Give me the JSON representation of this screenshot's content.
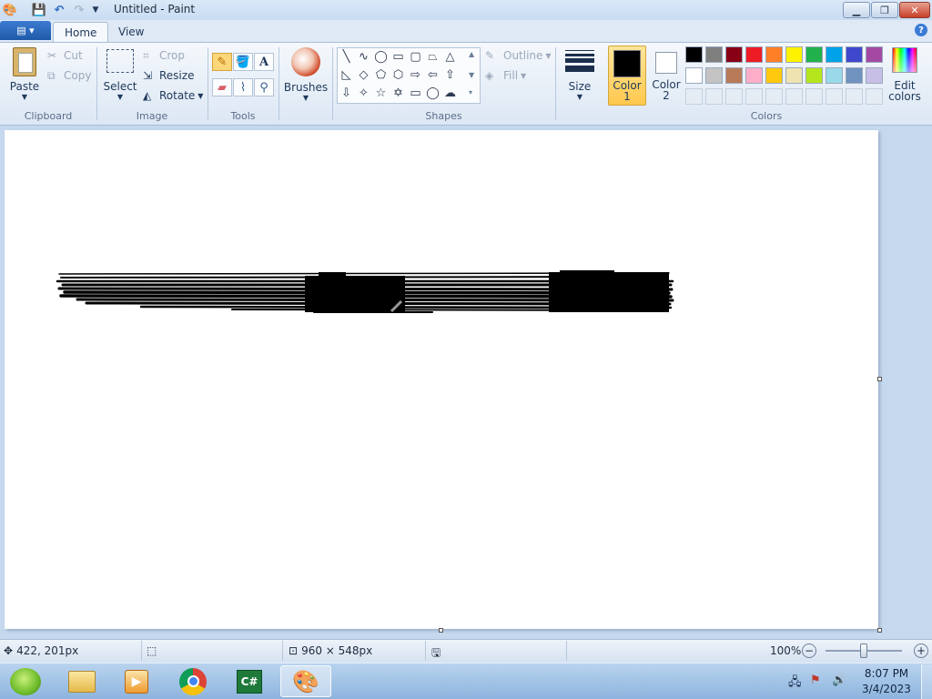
{
  "window": {
    "title": "Untitled - Paint"
  },
  "tabs": [
    {
      "label": "Home"
    },
    {
      "label": "View"
    }
  ],
  "clipboard": {
    "paste": "Paste",
    "cut": "Cut",
    "copy": "Copy",
    "label": "Clipboard"
  },
  "image": {
    "select": "Select",
    "crop": "Crop",
    "resize": "Resize",
    "rotate": "Rotate",
    "label": "Image"
  },
  "tools": {
    "label": "Tools"
  },
  "brushes": {
    "label": "Brushes"
  },
  "shapes": {
    "outline": "Outline",
    "fill": "Fill",
    "label": "Shapes"
  },
  "size": {
    "label": "Size"
  },
  "colors": {
    "color1": "Color",
    "color1_num": "1",
    "color2": "Color",
    "color2_num": "2",
    "edit": "Edit",
    "edit2": "colors",
    "label": "Colors",
    "palette_row1": [
      "#000000",
      "#7f7f7f",
      "#880015",
      "#ed1c24",
      "#ff7f27",
      "#fff200",
      "#22b14c",
      "#00a2e8",
      "#3f48cc",
      "#a349a4"
    ],
    "palette_row2": [
      "#ffffff",
      "#c3c3c3",
      "#b97a57",
      "#ffaec9",
      "#ffc90e",
      "#efe4b0",
      "#b5e61d",
      "#99d9ea",
      "#7092be",
      "#c8bfe7"
    ]
  },
  "status": {
    "cursor": "422, 201px",
    "canvas_size": "960 × 548px",
    "zoom": "100%"
  },
  "zoom": {
    "level": 0.5
  },
  "taskbar": {
    "time": "8:07 PM",
    "date": "3/4/2023"
  }
}
